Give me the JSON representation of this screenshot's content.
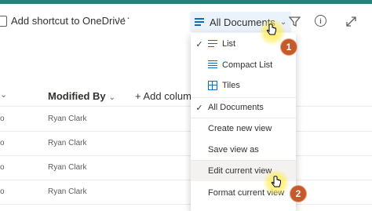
{
  "commandbar": {
    "add_shortcut_label": "Add shortcut to OneDrive",
    "more_label": "···",
    "view_selector_label": "All Documents"
  },
  "list": {
    "columns": {
      "modified_by": "Modified By",
      "add_column": "+ Add column"
    },
    "rows": [
      {
        "left_fragment": "o",
        "modified_by": "Ryan Clark"
      },
      {
        "left_fragment": "o",
        "modified_by": "Ryan Clark"
      },
      {
        "left_fragment": "o",
        "modified_by": "Ryan Clark"
      },
      {
        "left_fragment": "o",
        "modified_by": "Ryan Clark"
      }
    ]
  },
  "view_menu": {
    "layout_options": [
      {
        "label": "List",
        "checked": true,
        "icon": "list-icon"
      },
      {
        "label": "Compact List",
        "checked": false,
        "icon": "compact-list-icon"
      },
      {
        "label": "Tiles",
        "checked": false,
        "icon": "tiles-icon"
      }
    ],
    "views": [
      {
        "label": "All Documents",
        "checked": true
      }
    ],
    "actions": [
      {
        "label": "Create new view"
      },
      {
        "label": "Save view as"
      },
      {
        "label": "Edit current view",
        "highlighted": true
      },
      {
        "label": "Format current view"
      }
    ]
  },
  "callouts": [
    {
      "number": "1"
    },
    {
      "number": "2"
    }
  ],
  "colors": {
    "top_bar": "#2d7d7a",
    "accent": "#0f6cbd",
    "callout": "#c55a2b",
    "highlight_glow": "#ffeb50"
  }
}
